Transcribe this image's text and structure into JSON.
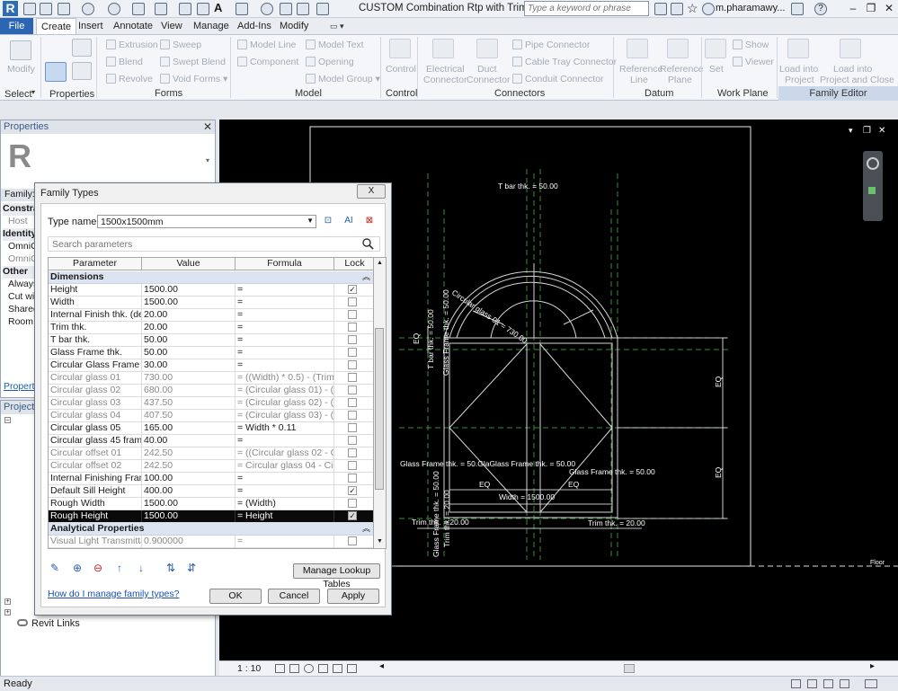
{
  "app": {
    "title": "CUSTOM Combination Rtp with Trim...",
    "search_placeholder": "Type a keyword or phrase",
    "user": "m.pharamawy...",
    "logo_letter": "R"
  },
  "tabs": [
    "File",
    "Create",
    "Insert",
    "Annotate",
    "View",
    "Manage",
    "Add-Ins",
    "Modify"
  ],
  "ribbon": {
    "select": {
      "modify": "Modify",
      "title": "Select"
    },
    "properties": {
      "title": "Properties"
    },
    "forms": {
      "items": [
        "Extrusion",
        "Blend",
        "Revolve",
        "Sweep",
        "Swept Blend",
        "Void Forms"
      ],
      "title": "Forms"
    },
    "model": {
      "items": [
        "Model Line",
        "Component",
        "Model Group",
        "Model Text",
        "Opening"
      ],
      "title": "Model"
    },
    "control": {
      "item": "Control",
      "title": "Control"
    },
    "connectors": {
      "items": [
        "Electrical",
        "Connector",
        "Duct",
        "Connector",
        "Pipe Connector",
        "Cable Tray Connector",
        "Conduit Connector"
      ],
      "title": "Connectors"
    },
    "datum": {
      "items": [
        "Reference",
        "Line",
        "Reference",
        "Plane"
      ],
      "title": "Datum"
    },
    "workplane": {
      "items": [
        "Set",
        "Show",
        "Viewer"
      ],
      "title": "Work Plane"
    },
    "family_editor": {
      "items": [
        "Load into",
        "Project",
        "Load into",
        "Project and Close"
      ],
      "title": "Family Editor"
    }
  },
  "properties_panel": {
    "title": "Properties",
    "rows": [
      "Family:",
      "Constrai",
      "Host",
      "Identity",
      "OmniC",
      "OmniC",
      "Other",
      "Always",
      "Cut wit",
      "Shared",
      "Room C"
    ],
    "link": "Properties"
  },
  "project_browser": {
    "title": "Project B",
    "revit_links": "Revit Links"
  },
  "dialog": {
    "title": "Family Types",
    "close": "X",
    "type_name_label": "Type name:",
    "type_name_value": "1500x1500mm",
    "search_placeholder": "Search parameters",
    "columns": [
      "Parameter",
      "Value",
      "Formula",
      "Lock"
    ],
    "groups": {
      "dimensions": "Dimensions",
      "analytical": "Analytical Properties"
    },
    "rows": [
      {
        "name": "Height",
        "value": "1500.00",
        "formula": "=",
        "lock": "✓"
      },
      {
        "name": "Width",
        "value": "1500.00",
        "formula": "=",
        "lock": ""
      },
      {
        "name": "Internal Finish thk. (defa",
        "value": "20.00",
        "formula": "=",
        "lock": ""
      },
      {
        "name": "Trim thk.",
        "value": "20.00",
        "formula": "=",
        "lock": ""
      },
      {
        "name": "T bar thk.",
        "value": "50.00",
        "formula": "=",
        "lock": ""
      },
      {
        "name": "Glass Frame thk.",
        "value": "50.00",
        "formula": "=",
        "lock": ""
      },
      {
        "name": "Circular Glass Frame thk.",
        "value": "30.00",
        "formula": "=",
        "lock": ""
      },
      {
        "name": "Circular glass 01",
        "value": "730.00",
        "formula": "= ((Width) * 0.5) - (Trim th",
        "lock": ""
      },
      {
        "name": "Circular glass 02",
        "value": "680.00",
        "formula": "= (Circular glass 01) - (Gla",
        "lock": ""
      },
      {
        "name": "Circular glass 03",
        "value": "437.50",
        "formula": "= (Circular glass 02) - (Circ",
        "lock": ""
      },
      {
        "name": "Circular glass 04",
        "value": "407.50",
        "formula": "= (Circular glass 03) - (Circ",
        "lock": ""
      },
      {
        "name": "Circular glass 05",
        "value": "165.00",
        "formula": "= Width * 0.11",
        "lock": ""
      },
      {
        "name": "Circular glass 45 frame",
        "value": "40.00",
        "formula": "=",
        "lock": ""
      },
      {
        "name": "Circular offset 01",
        "value": "242.50",
        "formula": "= ((Circular glass 02 - Circ",
        "lock": ""
      },
      {
        "name": "Circular offset 02",
        "value": "242.50",
        "formula": "= Circular glass 04 - Circul",
        "lock": ""
      },
      {
        "name": "Internal Finishing Frame",
        "value": "100.00",
        "formula": "=",
        "lock": ""
      },
      {
        "name": "Default Sill Height",
        "value": "400.00",
        "formula": "=",
        "lock": "✓"
      },
      {
        "name": "Rough Width",
        "value": "1500.00",
        "formula": "= (Width)",
        "lock": ""
      },
      {
        "name": "Rough Height",
        "value": "1500.00",
        "formula": "= Height",
        "lock": "✓"
      }
    ],
    "analytical_rows": [
      {
        "name": "Visual Light Transmittan",
        "value": "0.900000",
        "formula": "=",
        "lock": ""
      }
    ],
    "manage_lookup": "Manage Lookup Tables",
    "help_link": "How do I manage family types?",
    "ok": "OK",
    "cancel": "Cancel",
    "apply": "Apply"
  },
  "drawing": {
    "labels": {
      "tbar_top": "T bar thk. = 50.00",
      "circular_glass": "Circular glass 01 = 730.00",
      "glass_frame_left_v": "Glass Frame thk. = 50.00",
      "tbar_left_v": "T bar thk. = 50.00",
      "eq_left_v": "EQ",
      "eq_right_1": "EQ",
      "eq_right_2": "EQ",
      "glass_frame_mid": "Glass Frame thk. = 50.GlaGlass Frame thk. = 50.00",
      "glass_frame_right": "Glass Frame thk. = 50.00",
      "eq_bottom_1": "EQ",
      "eq_bottom_2": "EQ",
      "width": "Width = 1500.00",
      "trim_left": "Trim thk. = 20.00",
      "trim_right": "Trim thk. = 20.00",
      "glass_frame_bottom_v": "Glass Frame thk. = 50.00",
      "trim_bottom_v": "Trim thk. = 20.00",
      "floor": "Floor"
    }
  },
  "view": {
    "scale": "1 : 10"
  },
  "status": {
    "text": "Ready"
  }
}
